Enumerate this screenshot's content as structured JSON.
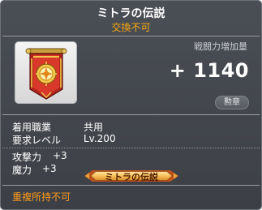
{
  "item": {
    "name": "ミトラの伝説",
    "trade_status": "交換不可",
    "icon": "mitra-banner-medal-icon"
  },
  "combat_power": {
    "label": "戦闘力増加量",
    "value": "+ 1140"
  },
  "category_badge": "勲章",
  "requirements": [
    {
      "label": "着用職業",
      "value": "共用"
    },
    {
      "label": "要求レベル",
      "value": "Lv.200"
    }
  ],
  "stats": [
    {
      "label": "攻撃力",
      "value": "+3"
    },
    {
      "label": "魔力",
      "value": "+3"
    }
  ],
  "medal_title": "ミトラの伝説",
  "footer_note": "重複所持不可",
  "colors": {
    "trade_status": "#ffaa11",
    "footer_note": "#ff9a1a",
    "background": "#43474d"
  }
}
